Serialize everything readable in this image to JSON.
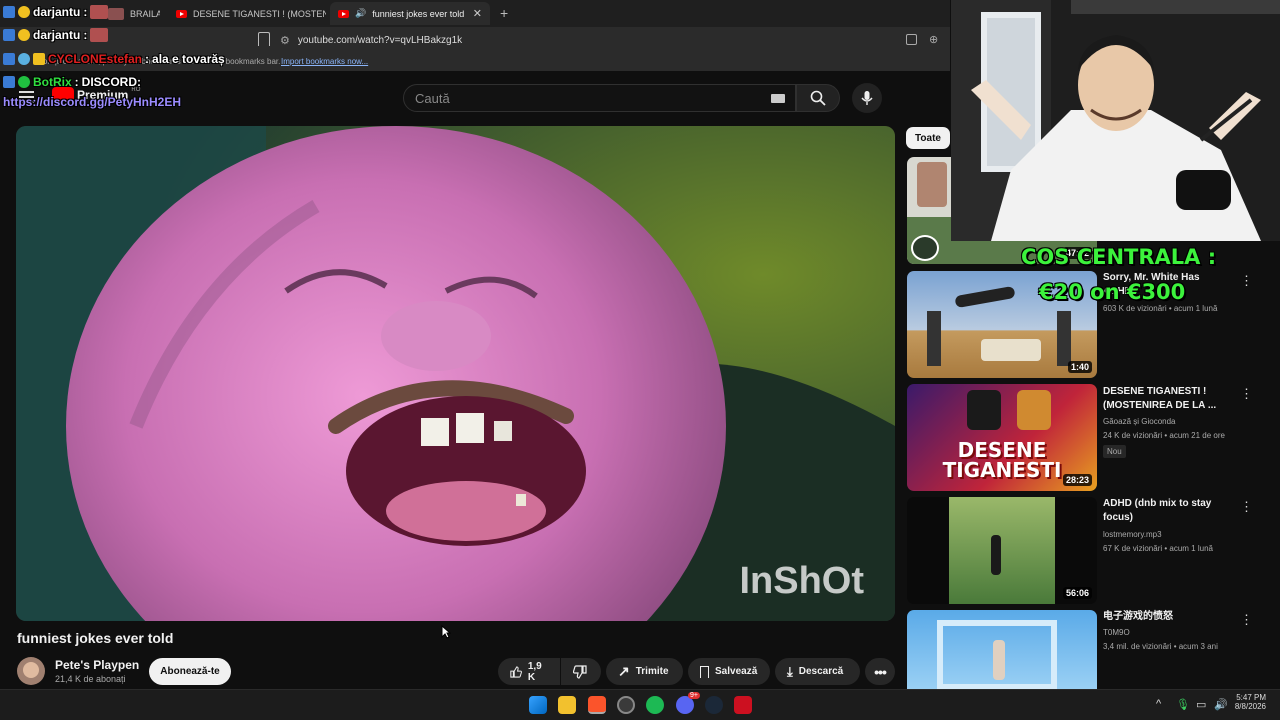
{
  "browser": {
    "tabs": [
      {
        "label": "BRAILA"
      },
      {
        "label": "DESENE TIGANESTI ! (MOSTENIREA D"
      },
      {
        "label": "funniest jokes ever told - You"
      }
    ],
    "new_tab_symbol": "+",
    "url": "youtube.com/watch?v=qvLHBakzg1k",
    "bookmarks_hint": "For quick access, place your bookmarks here on the bookmarks bar.",
    "import_link": "Import bookmarks now..."
  },
  "youtube": {
    "logo_text": "Premium",
    "logo_region": "RO",
    "search_placeholder": "Caută",
    "video": {
      "title": "funniest jokes ever told",
      "watermark": "InShOt"
    },
    "channel": {
      "name": "Pete's Playpen",
      "subscribers": "21,4 K de abonați"
    },
    "subscribe_label": "Abonează-te",
    "like_count": "1,9 K",
    "share_label": "Trimite",
    "save_label": "Salvează",
    "download_label": "Descarcă",
    "filter_chip": "Toate",
    "recommendations": [
      {
        "duration": "47:02"
      },
      {
        "title": "Sorry, Mr. White Has ADHD",
        "meta": "603 K de vizionări • acum 1 lună",
        "duration": "1:40"
      },
      {
        "title": "DESENE TIGANESTI ! (MOSTENIREA DE LA ...",
        "channel": "Găoază și Gioconda",
        "meta": "24 K de vizionări • acum 21 de ore",
        "badge": "Nou",
        "duration": "28:23",
        "thumb_text": "DESENE TIGANESTI"
      },
      {
        "title": "ADHD (dnb mix to stay focus)",
        "channel": "lostmemory.mp3",
        "meta": "67 K de vizionări • acum 1 lună",
        "duration": "56:06"
      },
      {
        "title": "电子游戏的愤怒",
        "channel": "T0M9O",
        "meta": "3,4 mil. de vizionări • acum 3 ani"
      }
    ]
  },
  "overlay": {
    "promo_line1": "COS CENTRALA :",
    "promo_line2": "€20 on €300",
    "chat": [
      {
        "user": "darjantu",
        "message": ""
      },
      {
        "user": "darjantu",
        "message": ""
      },
      {
        "user": "CYCLONEstefan",
        "message": "ala e tovarăș"
      },
      {
        "user": "BotRix",
        "message": "DISCORD:"
      },
      {
        "user": "",
        "message": "https://discord.gg/PetyHnH2EH"
      }
    ],
    "chat_separator": " : "
  },
  "taskbar": {
    "time": "5:47 PM",
    "date": "8/8/2026",
    "discord_badge": "9+"
  },
  "colors": {
    "youtube_red": "#ff0000",
    "promo_green": "#3cf23c",
    "chat_link": "#9b8cff"
  }
}
